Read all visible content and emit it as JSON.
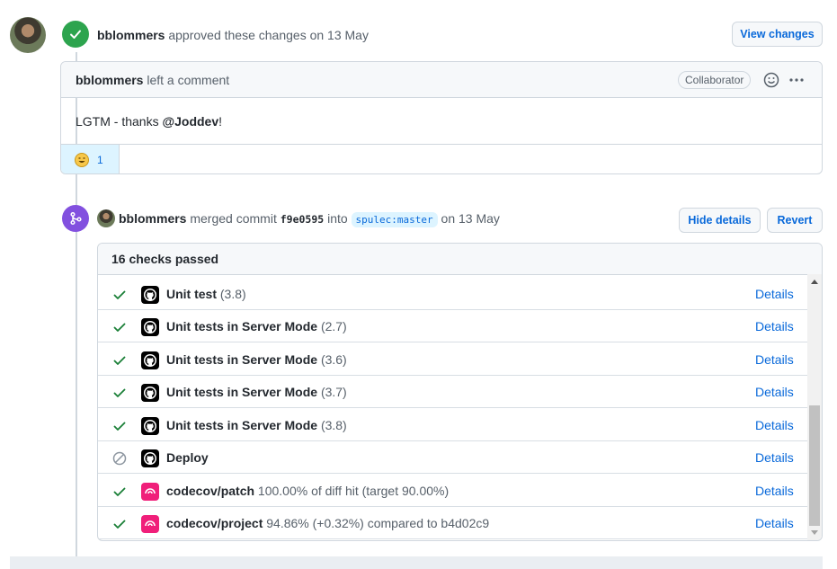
{
  "approval": {
    "author": "bblommers",
    "text": "approved these changes",
    "date": "on 13 May",
    "view_changes_label": "View changes"
  },
  "comment": {
    "author": "bblommers",
    "action": "left a comment",
    "role": "Collaborator",
    "body_prefix": "LGTM - thanks ",
    "mention": "@Joddev",
    "body_suffix": "!",
    "reaction_count": "1"
  },
  "merge": {
    "author": "bblommers",
    "action": "merged commit",
    "sha": "f9e0595",
    "into": "into",
    "branch": "spulec:master",
    "date": "on 13 May",
    "hide_details_label": "Hide details",
    "revert_label": "Revert"
  },
  "checks": {
    "summary": "16 checks passed",
    "details_label": "Details",
    "items": [
      {
        "name": "Unit test",
        "desc": "(3.8)",
        "status": "success",
        "app": "github"
      },
      {
        "name": "Unit tests in Server Mode",
        "desc": "(2.7)",
        "status": "success",
        "app": "github"
      },
      {
        "name": "Unit tests in Server Mode",
        "desc": "(3.6)",
        "status": "success",
        "app": "github"
      },
      {
        "name": "Unit tests in Server Mode",
        "desc": "(3.7)",
        "status": "success",
        "app": "github"
      },
      {
        "name": "Unit tests in Server Mode",
        "desc": "(3.8)",
        "status": "success",
        "app": "github"
      },
      {
        "name": "Deploy",
        "desc": "",
        "status": "skipped",
        "app": "github"
      },
      {
        "name": "codecov/patch",
        "desc": "100.00% of diff hit (target 90.00%)",
        "status": "success",
        "app": "codecov"
      },
      {
        "name": "codecov/project",
        "desc": "94.86% (+0.32%) compared to b4d02c9",
        "status": "success",
        "app": "codecov"
      }
    ]
  },
  "colors": {
    "success": "#1a7f37",
    "approve_badge": "#2da44e",
    "merge_badge": "#8250df",
    "link": "#0969da",
    "codecov": "#f01f7a"
  }
}
